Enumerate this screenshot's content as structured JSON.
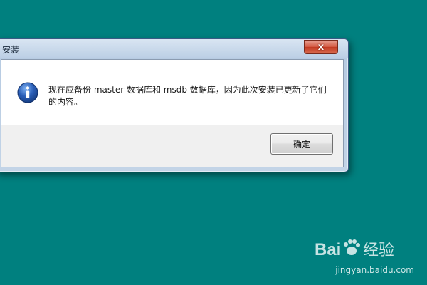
{
  "window": {
    "title": "安装",
    "close_glyph": "x",
    "message": "现在应备份 master 数据库和 msdb 数据库，因为此次安装已更新了它们的内容。",
    "ok_label": "确定",
    "icon": "info-icon"
  },
  "watermark": {
    "logo_text": "Bai 经验",
    "url": "jingyan.baidu.com"
  },
  "colors": {
    "desktop": "#00807f",
    "close_button": "#c9432b",
    "info_icon": "#2b5fb8"
  }
}
